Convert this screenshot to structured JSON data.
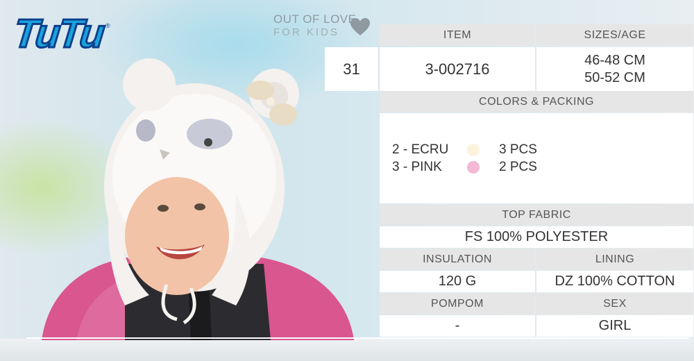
{
  "brand": {
    "logo_text": "TuTu",
    "registered": "®"
  },
  "tagline": {
    "line1": "OUT OF LOVE",
    "line2": "FOR KIDS"
  },
  "product": {
    "number": "31",
    "item_header": "ITEM",
    "item": "3-002716",
    "sizes_header": "SIZES/AGE",
    "sizes": [
      "46-48 CM",
      "50-52 CM"
    ]
  },
  "colors_packing": {
    "header": "COLORS & PACKING",
    "items": [
      {
        "name": "2 - ECRU",
        "color": "#fbf3dc",
        "packing": "3 PCS"
      },
      {
        "name": "3 - PINK",
        "color": "#f2b8d4",
        "packing": "2 PCS"
      }
    ]
  },
  "top_fabric": {
    "header": "TOP FABRIC",
    "value": "FS 100% POLYESTER"
  },
  "insulation": {
    "header": "INSULATION",
    "value": "120 G"
  },
  "lining": {
    "header": "LINING",
    "value": "DZ 100% COTTON"
  },
  "pompom": {
    "header": "POMPOM",
    "value": "-"
  },
  "sex": {
    "header": "SEX",
    "value": "GIRL"
  },
  "colors": {
    "header_bg": "#e6e6e6",
    "logo_fill": "#1aa3dc",
    "logo_stroke": "#0c3f8c"
  }
}
